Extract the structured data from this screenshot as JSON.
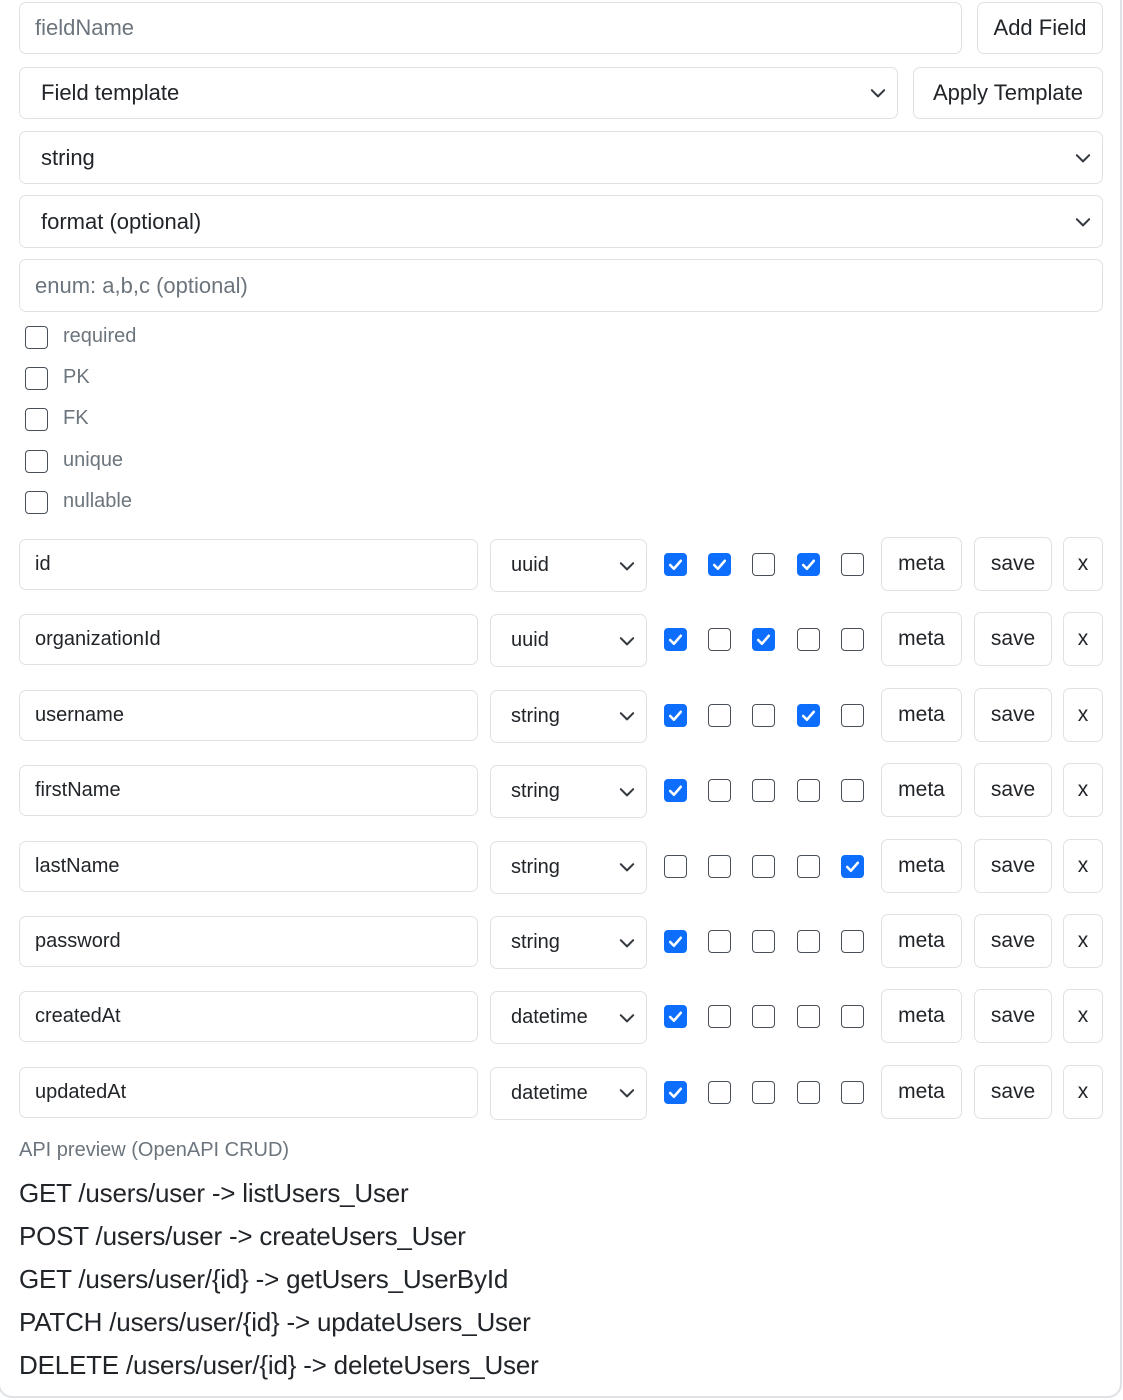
{
  "top": {
    "field_name_placeholder": "fieldName",
    "add_field_label": "Add Field",
    "template_select_value": "Field template",
    "apply_template_label": "Apply Template",
    "type_select_value": "string",
    "format_select_value": "format (optional)",
    "enum_placeholder": "enum: a,b,c (optional)"
  },
  "flags": [
    {
      "label": "required",
      "checked": false
    },
    {
      "label": "PK",
      "checked": false
    },
    {
      "label": "FK",
      "checked": false
    },
    {
      "label": "unique",
      "checked": false
    },
    {
      "label": "nullable",
      "checked": false
    }
  ],
  "fields": [
    {
      "name": "id",
      "type": "uuid",
      "flags": [
        true,
        true,
        false,
        true,
        false
      ]
    },
    {
      "name": "organizationId",
      "type": "uuid",
      "flags": [
        true,
        false,
        true,
        false,
        false
      ]
    },
    {
      "name": "username",
      "type": "string",
      "flags": [
        true,
        false,
        false,
        true,
        false
      ]
    },
    {
      "name": "firstName",
      "type": "string",
      "flags": [
        true,
        false,
        false,
        false,
        false
      ]
    },
    {
      "name": "lastName",
      "type": "string",
      "flags": [
        false,
        false,
        false,
        false,
        true
      ]
    },
    {
      "name": "password",
      "type": "string",
      "flags": [
        true,
        false,
        false,
        false,
        false
      ]
    },
    {
      "name": "createdAt",
      "type": "datetime",
      "flags": [
        true,
        false,
        false,
        false,
        false
      ]
    },
    {
      "name": "updatedAt",
      "type": "datetime",
      "flags": [
        true,
        false,
        false,
        false,
        false
      ]
    }
  ],
  "row_buttons": {
    "meta": "meta",
    "save": "save",
    "remove": "x"
  },
  "api_preview": {
    "label": "API preview (OpenAPI CRUD)",
    "routes": [
      "GET /users/user -> listUsers_User",
      "POST /users/user -> createUsers_User",
      "GET /users/user/{id} -> getUsers_UserById",
      "PATCH /users/user/{id} -> updateUsers_User",
      "DELETE /users/user/{id} -> deleteUsers_User"
    ]
  },
  "colors": {
    "accent": "#0d6efd",
    "border": "#dee2e6",
    "muted": "#6c757d"
  }
}
